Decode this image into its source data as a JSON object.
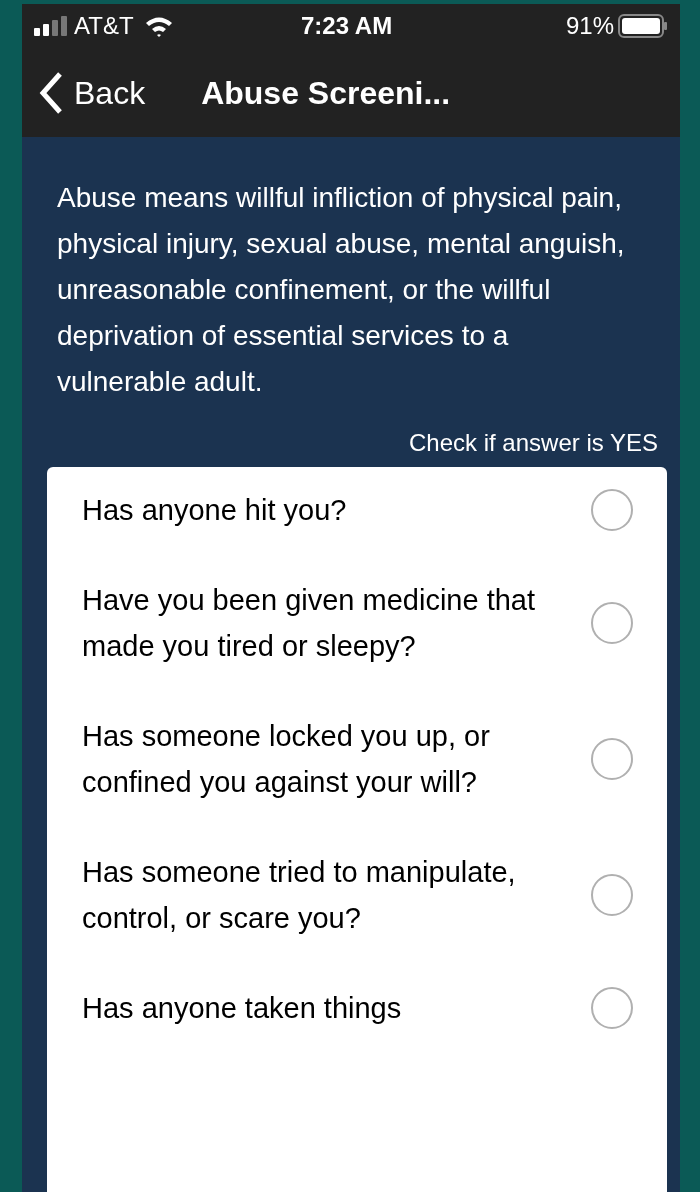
{
  "status_bar": {
    "carrier": "AT&T",
    "time": "7:23 AM",
    "battery": "91%"
  },
  "nav": {
    "back": "Back",
    "title": "Abuse Screeni..."
  },
  "intro": "Abuse means willful infliction of physical pain, physical injury, sexual abuse, mental anguish, unreasonable confinement, or the willful deprivation of essential services to a vulnerable adult.",
  "hint": "Check if answer is YES",
  "questions": [
    {
      "text": "Has anyone hit you?",
      "checked": false
    },
    {
      "text": "Have you been given medicine that made you tired or sleepy?",
      "checked": false
    },
    {
      "text": "Has someone locked you up, or confined you against your will?",
      "checked": false
    },
    {
      "text": "Has someone tried to manipulate, control, or scare you?",
      "checked": false
    },
    {
      "text": "Has anyone taken things",
      "checked": false
    }
  ]
}
